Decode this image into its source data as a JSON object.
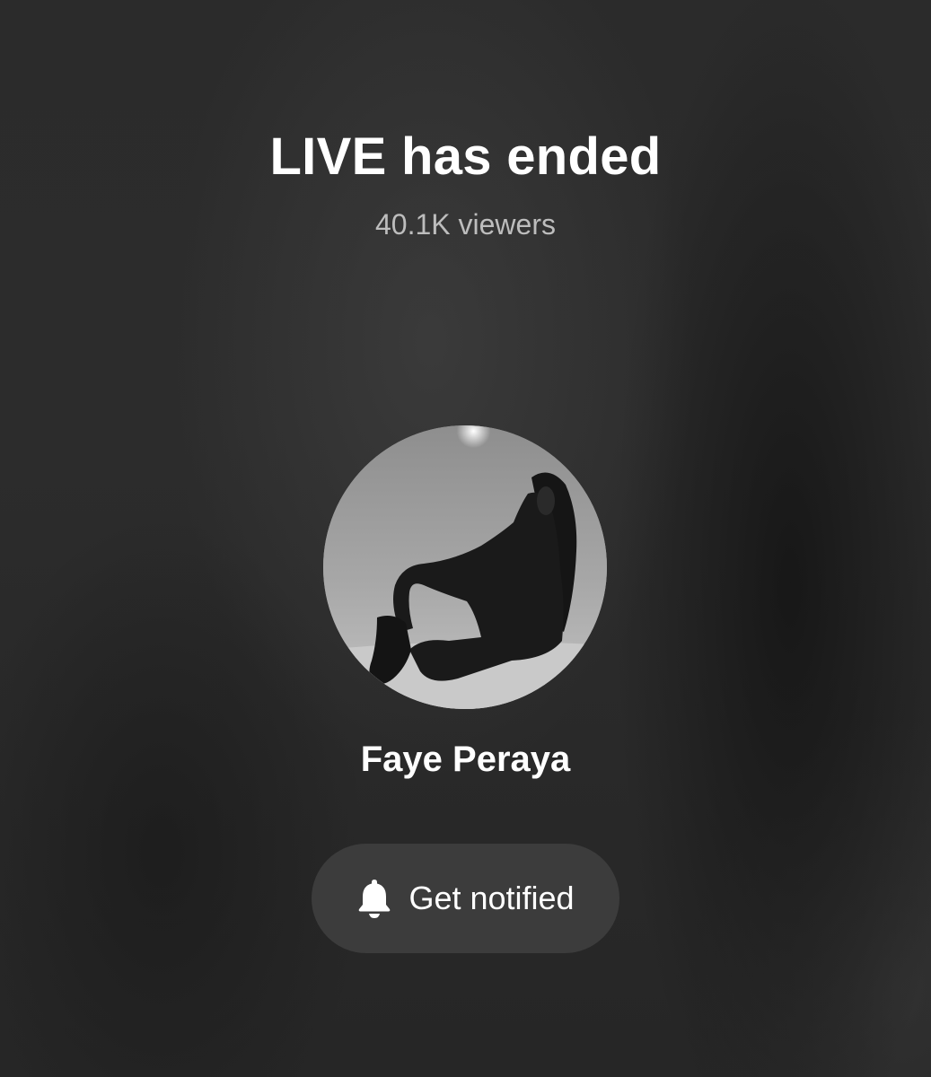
{
  "live": {
    "title": "LIVE has ended",
    "viewers": "40.1K viewers"
  },
  "profile": {
    "name": "Faye Peraya",
    "avatar_icon": "profile-photo"
  },
  "actions": {
    "notify_label": "Get notified",
    "notify_icon": "bell-icon"
  },
  "colors": {
    "background": "#2a2a2a",
    "button_bg": "#3c3c3c",
    "subtext": "#bdbdbd"
  }
}
